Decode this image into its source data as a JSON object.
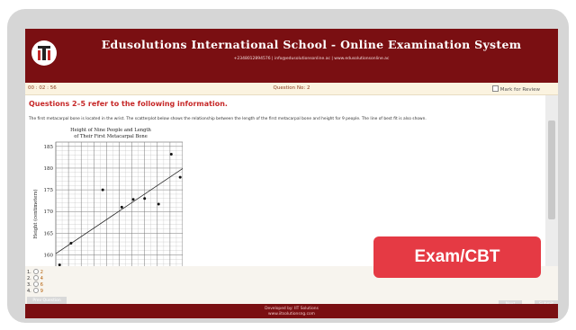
{
  "header": {
    "title": "Edusolutions International School - Online Examination System",
    "contact": "+2348012894576 | info@edusolutionsonline.ac | www.edusolutionsonline.ac"
  },
  "qbar": {
    "timer": "00 : 02 : 56",
    "question_no": "Question No: 2",
    "mark_review": "Mark for Review"
  },
  "question": {
    "heading": "Questions 2–5 refer to the following information.",
    "description": "The first metacarpal bone is located in the wrist. The scatterplot below shows the relationship between the length of the first metacarpal bone and height for 9 people. The line of best fit is also shown."
  },
  "chart_data": {
    "type": "scatter",
    "title": "Height of Nine People and Length of Their First Metacarpal Bone",
    "ylabel": "Height (centimeters)",
    "y_ticks": [
      160,
      165,
      170,
      175,
      180,
      185
    ],
    "ylim": [
      157,
      186
    ],
    "xlim": [
      0,
      10
    ],
    "grid": true,
    "points": [
      {
        "x": 0.3,
        "y": 157.7
      },
      {
        "x": 1.2,
        "y": 162.7
      },
      {
        "x": 3.7,
        "y": 175.0
      },
      {
        "x": 5.2,
        "y": 171.0
      },
      {
        "x": 6.1,
        "y": 172.8
      },
      {
        "x": 7.0,
        "y": 173.0
      },
      {
        "x": 8.1,
        "y": 171.7
      },
      {
        "x": 9.1,
        "y": 183.2
      },
      {
        "x": 9.8,
        "y": 177.9
      }
    ],
    "best_fit": {
      "x1": 0,
      "y1": 160.3,
      "x2": 10,
      "y2": 179.9
    }
  },
  "options": [
    {
      "num": "1.",
      "value": "2"
    },
    {
      "num": "2.",
      "value": "4"
    },
    {
      "num": "3.",
      "value": "6"
    },
    {
      "num": "4.",
      "value": "9"
    }
  ],
  "buttons": {
    "prev": "Prev Question",
    "next": "Next",
    "submit": "Submit"
  },
  "badge": "Exam/CBT",
  "footer": {
    "line1": "Developed by: IIT Solutions",
    "line2": "www.iitsolutionsng.com"
  },
  "colors": {
    "header_bg": "#7a0f12",
    "heading": "#c62828",
    "badge_bg": "#e53a44"
  }
}
